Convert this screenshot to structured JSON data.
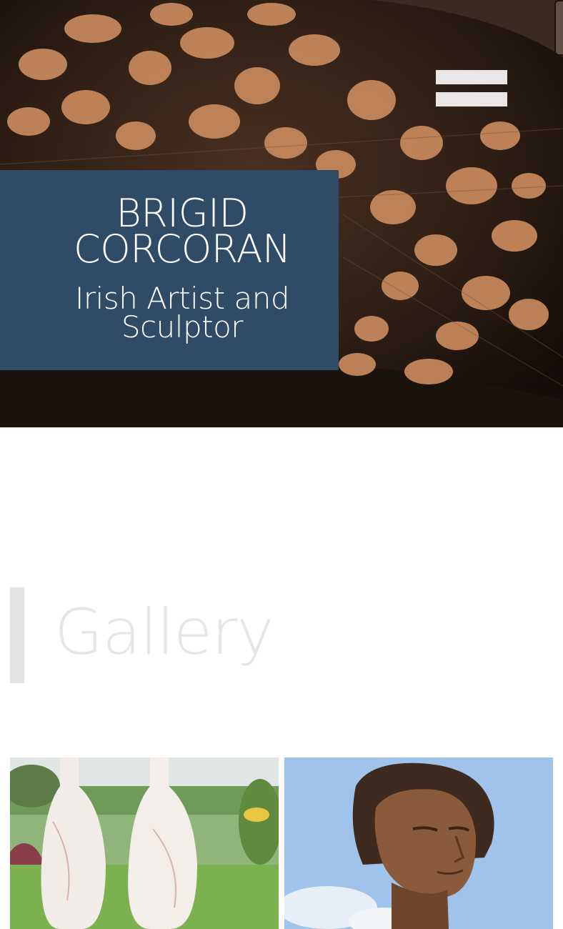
{
  "header": {
    "site_name": "BRIGID CORCORAN",
    "tagline": "Irish Artist and Sculptor",
    "menu_icon": "hamburger-menu-icon",
    "hero_image": "carved-wood-texture"
  },
  "colors": {
    "title_box": "#2f4b66",
    "menu_bars": "#e8e6e6",
    "heading_text": "#e6e6e6",
    "accent_bar": "#e4e2e4"
  },
  "gallery": {
    "heading": "Gallery",
    "items": [
      {
        "image": "white-marble-bottle-sculptures"
      },
      {
        "image": "bronze-female-head-sculpture"
      }
    ]
  }
}
